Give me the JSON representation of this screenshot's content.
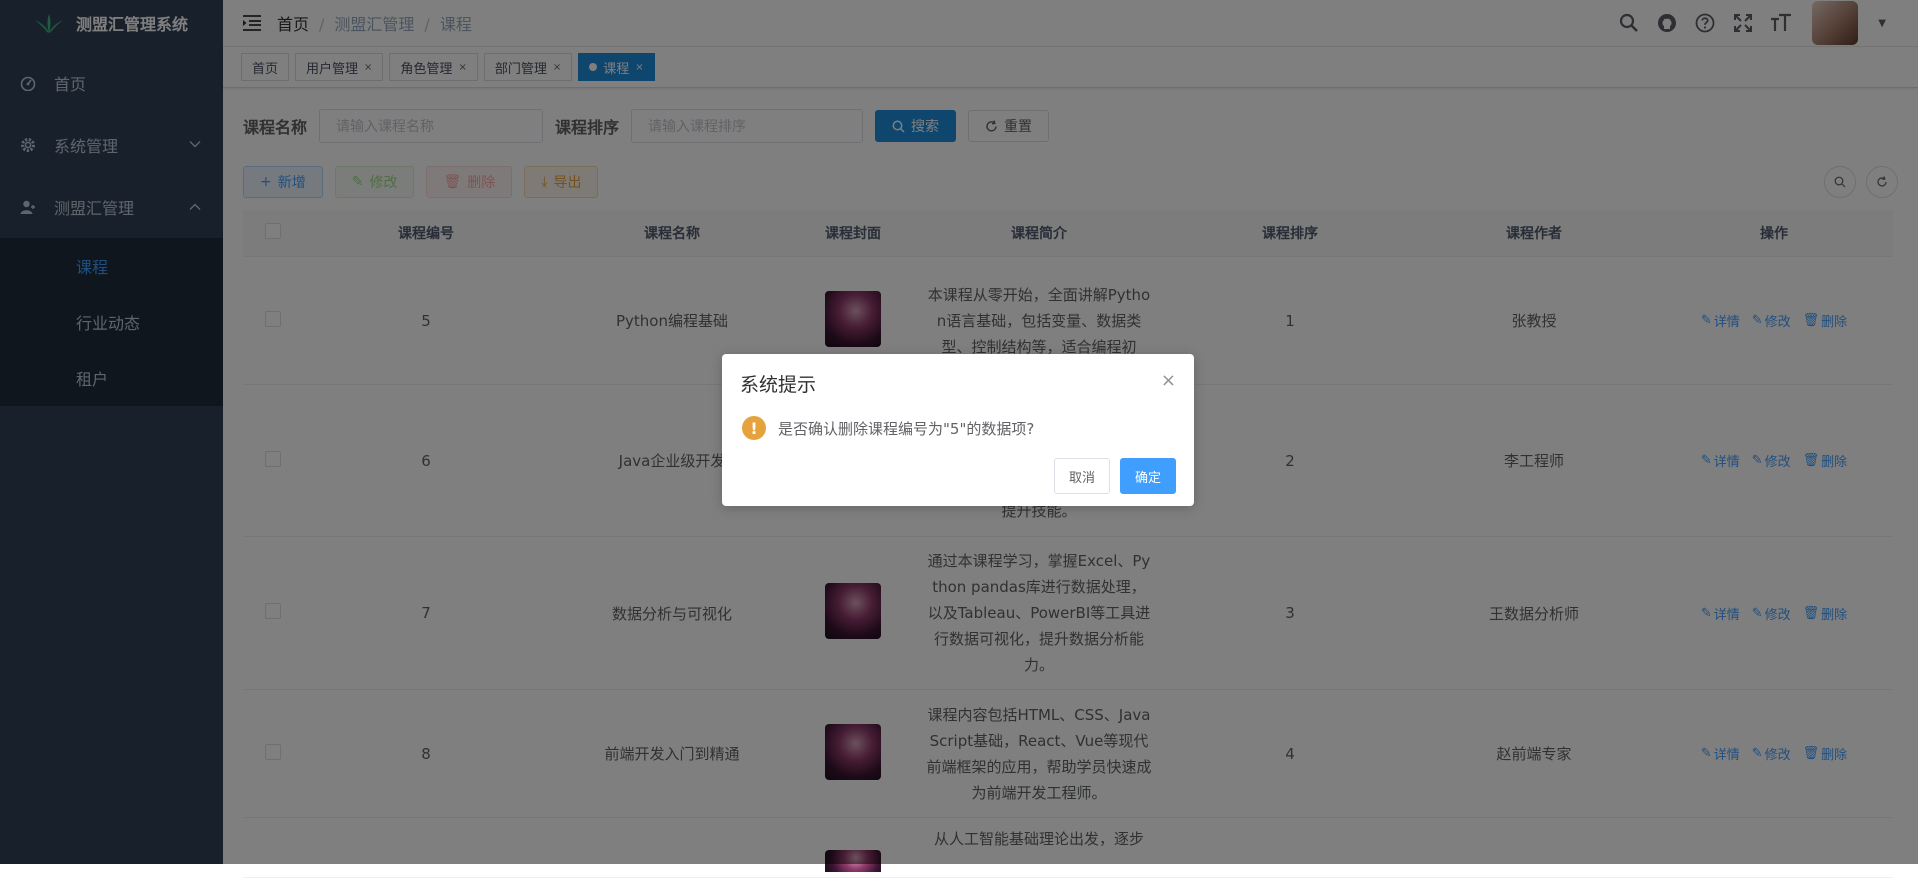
{
  "app": {
    "title": "测盟汇管理系统"
  },
  "sidebar": {
    "items": [
      {
        "label": "首页"
      },
      {
        "label": "系统管理"
      },
      {
        "label": "测盟汇管理"
      }
    ],
    "sub_items": [
      {
        "label": "课程"
      },
      {
        "label": "行业动态"
      },
      {
        "label": "租户"
      }
    ]
  },
  "breadcrumb": [
    "首页",
    "测盟汇管理",
    "课程"
  ],
  "tags": [
    {
      "label": "首页"
    },
    {
      "label": "用户管理",
      "close": "×"
    },
    {
      "label": "角色管理",
      "close": "×"
    },
    {
      "label": "部门管理",
      "close": "×"
    },
    {
      "label": "课程",
      "close": "×"
    }
  ],
  "search": {
    "name_label": "课程名称",
    "name_placeholder": "请输入课程名称",
    "sort_label": "课程排序",
    "sort_placeholder": "请输入课程排序",
    "search_btn": "搜索",
    "reset_btn": "重置"
  },
  "toolbar": {
    "add": "新增",
    "edit": "修改",
    "delete": "删除",
    "export": "导出"
  },
  "table": {
    "headers": [
      "课程编号",
      "课程名称",
      "课程封面",
      "课程简介",
      "课程排序",
      "课程作者",
      "操作"
    ],
    "rows": [
      {
        "id": "5",
        "name": "Python编程基础",
        "desc": "本课程从零开始，全面讲解Python语言基础，包括变量、数据类型、控制结构等，适合编程初",
        "sort": "1",
        "author": "张教授"
      },
      {
        "id": "6",
        "name": "Java企业级开发",
        "desc": "提升技能。",
        "sort": "2",
        "author": "李工程师"
      },
      {
        "id": "7",
        "name": "数据分析与可视化",
        "desc": "通过本课程学习，掌握Excel、Python pandas库进行数据处理，以及Tableau、PowerBI等工具进行数据可视化，提升数据分析能力。",
        "sort": "3",
        "author": "王数据分析师"
      },
      {
        "id": "8",
        "name": "前端开发入门到精通",
        "desc": "课程内容包括HTML、CSS、JavaScript基础，React、Vue等现代前端框架的应用，帮助学员快速成为前端开发工程师。",
        "sort": "4",
        "author": "赵前端专家"
      },
      {
        "id": "",
        "name": "",
        "desc": "从人工智能基础理论出发，逐步",
        "sort": "",
        "author": ""
      }
    ],
    "ops": {
      "detail": "详情",
      "edit": "修改",
      "delete": "删除"
    }
  },
  "dialog": {
    "title": "系统提示",
    "message": "是否确认删除课程编号为\"5\"的数据项?",
    "cancel": "取消",
    "confirm": "确定",
    "close": "×"
  }
}
